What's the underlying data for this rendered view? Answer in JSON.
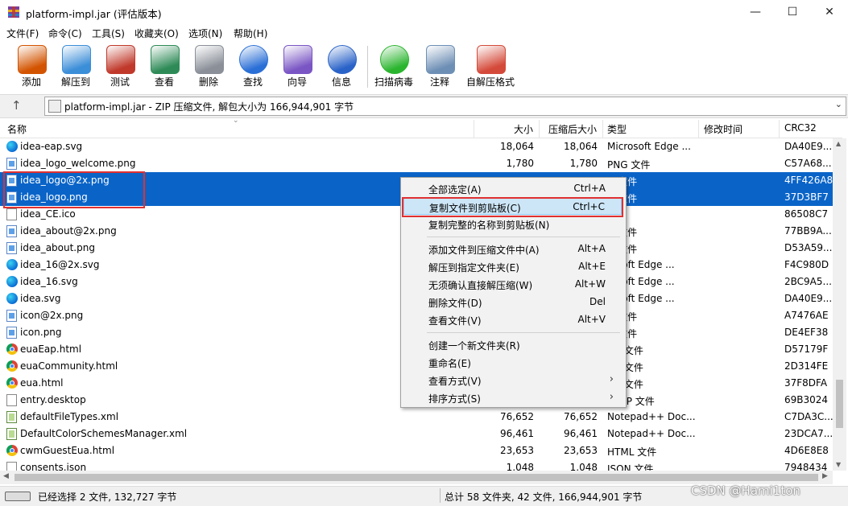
{
  "window": {
    "title": "platform-impl.jar (评估版本)",
    "buttons": [
      "—",
      "☐",
      "✕"
    ]
  },
  "menubar": [
    "文件(F)",
    "命令(C)",
    "工具(S)",
    "收藏夹(O)",
    "选项(N)",
    "帮助(H)"
  ],
  "toolbar": [
    {
      "label": "添加",
      "icon": "archive-add-icon",
      "color": "#d35400"
    },
    {
      "label": "解压到",
      "icon": "folder-extract-icon",
      "color": "#3b8ed8"
    },
    {
      "label": "测试",
      "icon": "clipboard-test-icon",
      "color": "#c0392b"
    },
    {
      "label": "查看",
      "icon": "book-view-icon",
      "color": "#2e8b57"
    },
    {
      "label": "删除",
      "icon": "trash-icon",
      "color": "#8a8f98"
    },
    {
      "label": "查找",
      "icon": "magnifier-icon",
      "color": "#2a6fd6"
    },
    {
      "label": "向导",
      "icon": "wizard-wand-icon",
      "color": "#7a55c4"
    },
    {
      "label": "信息",
      "icon": "info-icon",
      "color": "#2a63c8"
    },
    {
      "label": "扫描病毒",
      "icon": "virus-scan-icon",
      "color": "#2bb52f"
    },
    {
      "label": "注释",
      "icon": "comment-icon",
      "color": "#6e8fb5"
    },
    {
      "label": "自解压格式",
      "icon": "sfx-box-icon",
      "color": "#d44a3a"
    }
  ],
  "address": {
    "text": "platform-impl.jar - ZIP 压缩文件, 解包大小为 166,944,901 字节"
  },
  "columns": [
    "名称",
    "大小",
    "压缩后大小",
    "类型",
    "修改时间",
    "CRC32"
  ],
  "files": [
    {
      "name": "idea-eap.svg",
      "size": "18,064",
      "packed": "18,064",
      "type": "Microsoft Edge ...",
      "crc": "DA40E9...",
      "icon": "edge",
      "selected": false
    },
    {
      "name": "idea_logo_welcome.png",
      "size": "1,780",
      "packed": "1,780",
      "type": "PNG 文件",
      "crc": "C57A68...",
      "icon": "png",
      "selected": false
    },
    {
      "name": "idea_logo@2x.png",
      "size": "",
      "packed": "",
      "type": "G 文件",
      "crc": "4FF426A8",
      "icon": "png",
      "selected": true
    },
    {
      "name": "idea_logo.png",
      "size": "",
      "packed": "",
      "type": "G 文件",
      "crc": "37D3BF7",
      "icon": "png",
      "selected": true
    },
    {
      "name": "idea_CE.ico",
      "size": "",
      "packed": "",
      "type": "",
      "crc": "86508C7",
      "icon": "doc",
      "selected": false
    },
    {
      "name": "idea_about@2x.png",
      "size": "",
      "packed": "",
      "type": "G 文件",
      "crc": "77BB9A...",
      "icon": "png",
      "selected": false
    },
    {
      "name": "idea_about.png",
      "size": "",
      "packed": "",
      "type": "G 文件",
      "crc": "D53A59...",
      "icon": "png",
      "selected": false
    },
    {
      "name": "idea_16@2x.svg",
      "size": "",
      "packed": "",
      "type": "rosoft Edge ...",
      "crc": "F4C980D",
      "icon": "edge",
      "selected": false
    },
    {
      "name": "idea_16.svg",
      "size": "",
      "packed": "",
      "type": "rosoft Edge ...",
      "crc": "2BC9A5...",
      "icon": "edge",
      "selected": false
    },
    {
      "name": "idea.svg",
      "size": "",
      "packed": "",
      "type": "rosoft Edge ...",
      "crc": "DA40E9...",
      "icon": "edge",
      "selected": false
    },
    {
      "name": "icon@2x.png",
      "size": "",
      "packed": "",
      "type": "G 文件",
      "crc": "A7476AE",
      "icon": "png",
      "selected": false
    },
    {
      "name": "icon.png",
      "size": "",
      "packed": "",
      "type": "G 文件",
      "crc": "DE4EF38",
      "icon": "png",
      "selected": false
    },
    {
      "name": "euaEap.html",
      "size": "",
      "packed": "",
      "type": "ML 文件",
      "crc": "D57179F",
      "icon": "chrome",
      "selected": false
    },
    {
      "name": "euaCommunity.html",
      "size": "",
      "packed": "",
      "type": "ML 文件",
      "crc": "2D314FE",
      "icon": "chrome",
      "selected": false
    },
    {
      "name": "eua.html",
      "size": "",
      "packed": "",
      "type": "ML 文件",
      "crc": "37F8DFA",
      "icon": "chrome",
      "selected": false
    },
    {
      "name": "entry.desktop",
      "size": "",
      "packed": "",
      "type": "KTOP 文件",
      "crc": "69B3024",
      "icon": "doc",
      "selected": false
    },
    {
      "name": "defaultFileTypes.xml",
      "size": "76,652",
      "packed": "76,652",
      "type": "Notepad++ Doc...",
      "crc": "C7DA3C...",
      "icon": "xml",
      "selected": false
    },
    {
      "name": "DefaultColorSchemesManager.xml",
      "size": "96,461",
      "packed": "96,461",
      "type": "Notepad++ Doc...",
      "crc": "23DCA7...",
      "icon": "xml",
      "selected": false
    },
    {
      "name": "cwmGuestEua.html",
      "size": "23,653",
      "packed": "23,653",
      "type": "HTML 文件",
      "crc": "4D6E8E8",
      "icon": "chrome",
      "selected": false
    },
    {
      "name": "consents.json",
      "size": "1,048",
      "packed": "1,048",
      "type": "JSON 文件",
      "crc": "7948434",
      "icon": "doc",
      "selected": false
    }
  ],
  "context_menu": [
    {
      "label": "全部选定(A)",
      "shortcut": "Ctrl+A"
    },
    {
      "label": "复制文件到剪贴板(C)",
      "shortcut": "Ctrl+C",
      "highlighted": true
    },
    {
      "label": "复制完整的名称到剪贴板(N)",
      "shortcut": ""
    },
    {
      "sep": true
    },
    {
      "label": "添加文件到压缩文件中(A)",
      "shortcut": "Alt+A"
    },
    {
      "label": "解压到指定文件夹(E)",
      "shortcut": "Alt+E"
    },
    {
      "label": "无须确认直接解压缩(W)",
      "shortcut": "Alt+W"
    },
    {
      "label": "删除文件(D)",
      "shortcut": "Del"
    },
    {
      "label": "查看文件(V)",
      "shortcut": "Alt+V"
    },
    {
      "sep": true
    },
    {
      "label": "创建一个新文件夹(R)",
      "shortcut": ""
    },
    {
      "label": "重命名(E)",
      "shortcut": ""
    },
    {
      "label": "查看方式(V)",
      "shortcut": "",
      "submenu": true
    },
    {
      "label": "排序方式(S)",
      "shortcut": "",
      "submenu": true
    }
  ],
  "status": {
    "left": "已经选择 2 文件, 132,727 字节",
    "right": "总计 58 文件夹, 42 文件, 166,944,901 字节",
    "watermark": "CSDN @Hami1ton"
  }
}
